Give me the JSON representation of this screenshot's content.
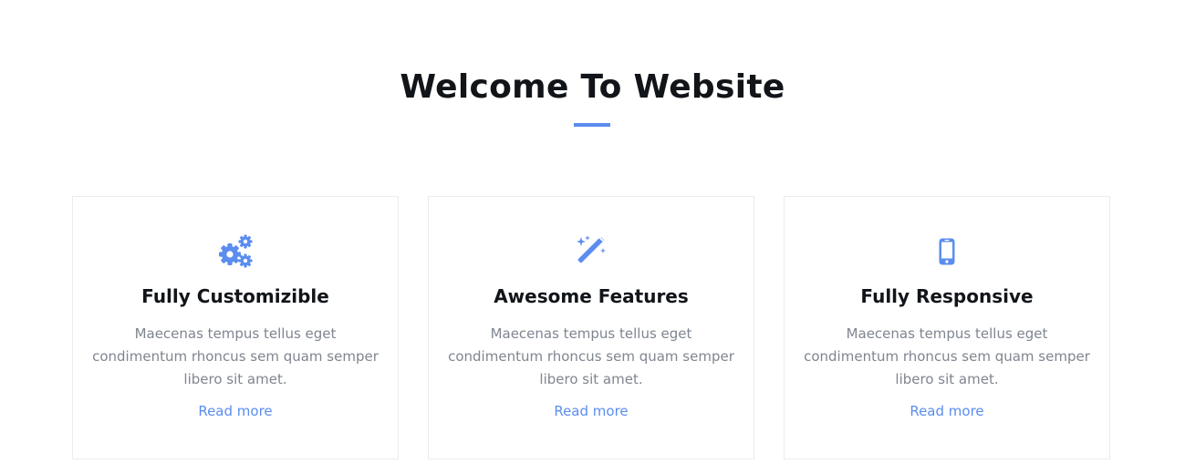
{
  "section": {
    "title": "Welcome To Website"
  },
  "accent_color": "#5b8def",
  "features": [
    {
      "icon": "gears-icon",
      "title": "Fully Customizible",
      "text": "Maecenas tempus tellus eget condimentum rhoncus sem quam semper libero sit amet.",
      "link": "Read more"
    },
    {
      "icon": "magic-wand-icon",
      "title": "Awesome Features",
      "text": "Maecenas tempus tellus eget condimentum rhoncus sem quam semper libero sit amet.",
      "link": "Read more"
    },
    {
      "icon": "mobile-phone-icon",
      "title": "Fully Responsive",
      "text": "Maecenas tempus tellus eget condimentum rhoncus sem quam semper libero sit amet.",
      "link": "Read more"
    }
  ]
}
